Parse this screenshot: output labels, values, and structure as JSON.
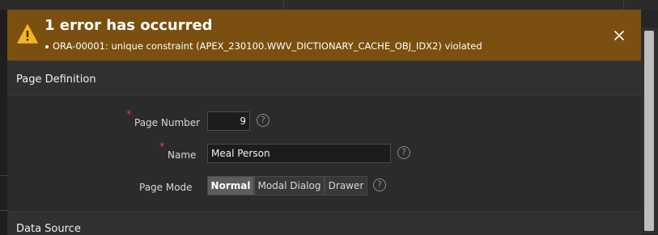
{
  "alert": {
    "title": "1 error has occurred",
    "messages": [
      "ORA-00001: unique constraint (APEX_230100.WWV_DICTIONARY_CACHE_OBJ_IDX2) violated"
    ],
    "icon": "warning-triangle-icon",
    "close_icon": "close-icon",
    "color": "#7a4f0f"
  },
  "sections": {
    "page_definition": "Page Definition",
    "data_source": "Data Source"
  },
  "form": {
    "page_number": {
      "label": "Page Number",
      "value": "9",
      "required": true
    },
    "name": {
      "label": "Name",
      "value": "Meal Person",
      "required": true
    },
    "page_mode": {
      "label": "Page Mode",
      "options": [
        "Normal",
        "Modal Dialog",
        "Drawer"
      ],
      "selected": "Normal"
    },
    "help_icon": "?"
  },
  "colors": {
    "required": "#e0442e",
    "background": "#2b2b2b"
  }
}
